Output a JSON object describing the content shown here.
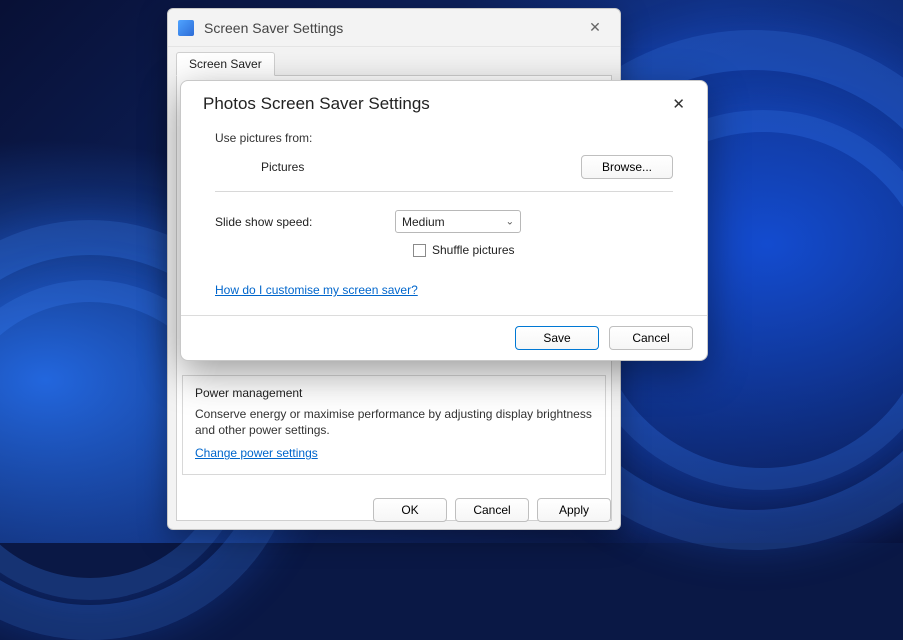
{
  "parent": {
    "title": "Screen Saver Settings",
    "tab_label": "Screen Saver",
    "power": {
      "heading": "Power management",
      "desc": "Conserve energy or maximise performance by adjusting display brightness and other power settings.",
      "link": "Change power settings"
    },
    "buttons": {
      "ok": "OK",
      "cancel": "Cancel",
      "apply": "Apply"
    }
  },
  "modal": {
    "title": "Photos Screen Saver Settings",
    "use_pictures_label": "Use pictures from:",
    "folder": "Pictures",
    "browse": "Browse...",
    "speed_label": "Slide show speed:",
    "speed_value": "Medium",
    "shuffle_label": "Shuffle pictures",
    "help_link": "How do I customise my screen saver?",
    "save": "Save",
    "cancel": "Cancel"
  }
}
